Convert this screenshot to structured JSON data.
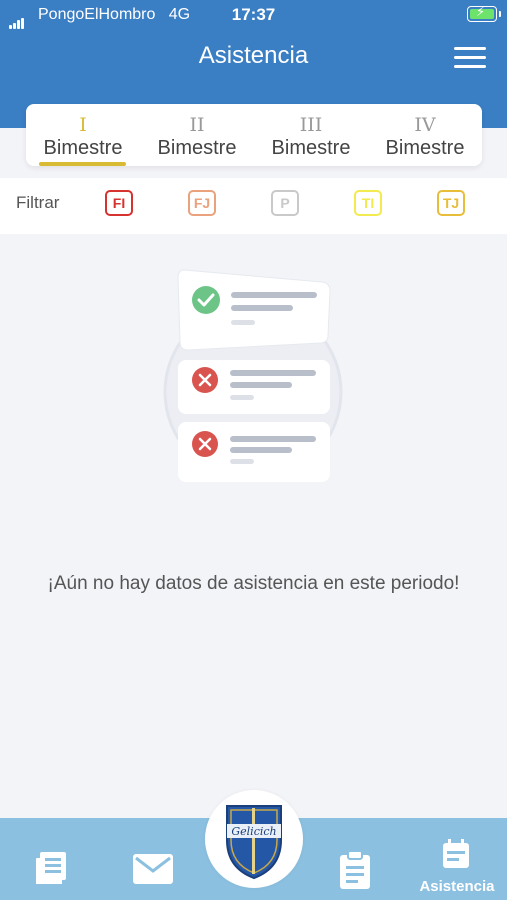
{
  "status_bar": {
    "carrier": "PongoElHombro",
    "network": "4G",
    "time": "17:37"
  },
  "header": {
    "title": "Asistencia"
  },
  "tabs": [
    {
      "number": "I",
      "label": "Bimestre",
      "active": true
    },
    {
      "number": "II",
      "label": "Bimestre",
      "active": false
    },
    {
      "number": "III",
      "label": "Bimestre",
      "active": false
    },
    {
      "number": "IV",
      "label": "Bimestre",
      "active": false
    }
  ],
  "filter": {
    "label": "Filtrar",
    "chips": [
      {
        "code": "FI",
        "color": "#d6322f"
      },
      {
        "code": "FJ",
        "color": "#e9a27c"
      },
      {
        "code": "P",
        "color": "#c9c9c9"
      },
      {
        "code": "TI",
        "color": "#f2ea4e"
      },
      {
        "code": "TJ",
        "color": "#e8bd3a"
      }
    ]
  },
  "empty_state": {
    "message": "¡Aún no hay datos de asistencia en este periodo!"
  },
  "bottom_nav": {
    "items": [
      {
        "icon": "newspaper-icon"
      },
      {
        "icon": "mail-icon"
      },
      {
        "icon": "school-crest-icon",
        "crest_text": "Gelicich"
      },
      {
        "icon": "clipboard-icon"
      },
      {
        "icon": "calendar-icon",
        "label": "Asistencia"
      }
    ]
  },
  "colors": {
    "header": "#3a7ec4",
    "tab_accent": "#d9bb33",
    "bottom_nav": "#8cc0e0",
    "background": "#f3f4f8"
  }
}
